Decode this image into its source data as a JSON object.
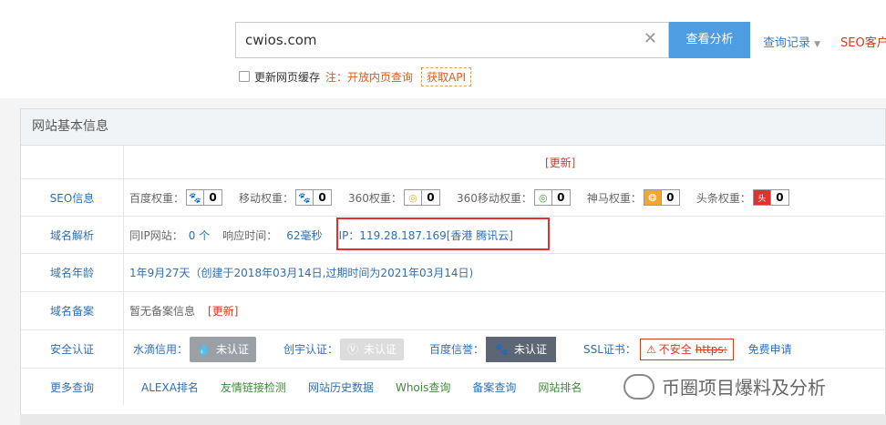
{
  "search": {
    "value": "cwios.com",
    "clear_icon": "close-icon",
    "button": "查看分析"
  },
  "header_links": {
    "history": "查询记录",
    "seo_client": "SEO客户"
  },
  "options": {
    "refresh_cache": "更新网页缓存",
    "note": "注：开放内页查询",
    "api": "获取API"
  },
  "panel": {
    "title": "网站基本信息",
    "update_link": "[更新]",
    "seo": {
      "label": "SEO信息",
      "items": [
        {
          "name": "百度权重：",
          "icon": "baidu-paw-icon",
          "value": "0"
        },
        {
          "name": "移动权重：",
          "icon": "baidu-paw-icon",
          "value": "0"
        },
        {
          "name": "360权重：",
          "icon": "360-icon",
          "value": "0"
        },
        {
          "name": "360移动权重：",
          "icon": "360-icon",
          "value": "0"
        },
        {
          "name": "神马权重：",
          "icon": "shenma-icon",
          "value": "0"
        },
        {
          "name": "头条权重：",
          "icon": "toutiao-icon",
          "value": "0"
        }
      ]
    },
    "dns": {
      "label": "域名解析",
      "same_ip_label": "同IP网站：",
      "same_ip_value": "0 个",
      "response_label": "响应时间：",
      "response_value": "62毫秒",
      "ip": "IP：119.28.187.169[香港 腾讯云]"
    },
    "age": {
      "label": "域名年龄",
      "value": "1年9月27天（创建于2018年03月14日,过期时间为2021年03月14日)"
    },
    "icp": {
      "label": "域名备案",
      "value": "暂无备案信息",
      "update": "[更新]"
    },
    "security": {
      "label": "安全认证",
      "shuidi_label": "水滴信用：",
      "shuidi_badge": "未认证",
      "chuangyu_label": "创宇认证：",
      "chuangyu_badge": "未认证",
      "baidu_label": "百度信誉：",
      "baidu_badge": "未认证",
      "ssl_label": "SSL证书：",
      "ssl_warning": "不安全",
      "ssl_https": "https:",
      "apply": "免费申请"
    },
    "more": {
      "label": "更多查询",
      "links": [
        "ALEXA排名",
        "友情链接检测",
        "网站历史数据",
        "Whois查询",
        "备案查询",
        "网站排名"
      ]
    }
  },
  "watermark": "币圈项目爆料及分析",
  "colors": {
    "accent": "#4e9de2",
    "link": "#2e6fb6",
    "red": "#d43b1f",
    "green": "#3f8a3a"
  }
}
